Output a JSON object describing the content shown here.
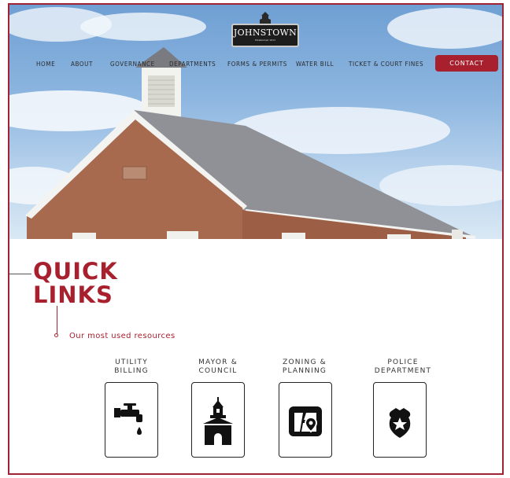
{
  "brand": {
    "logo_text": "JOHNSTOWN",
    "logo_sub": "Established 1813"
  },
  "nav": {
    "items": [
      "HOME",
      "ABOUT",
      "GOVERNANCE",
      "DEPARTMENTS",
      "FORMS & PERMITS",
      "WATER BILL",
      "TICKET & COURT FINES"
    ],
    "contact_label": "CONTACT"
  },
  "quick_links": {
    "title_line1": "QUICK",
    "title_line2": "LINKS",
    "tagline": "Our most used resources",
    "cards": [
      {
        "line1": "UTILITY",
        "line2": "BILLING",
        "icon": "faucet-icon"
      },
      {
        "line1": "MAYOR &",
        "line2": "COUNCIL",
        "icon": "town-hall-icon"
      },
      {
        "line1": "ZONING &",
        "line2": "PLANNING",
        "icon": "map-pin-icon"
      },
      {
        "line1": "POLICE",
        "line2": "DEPARTMENT",
        "icon": "police-badge-icon"
      }
    ]
  },
  "colors": {
    "accent": "#a8202d",
    "sky": "#8db6e0"
  }
}
